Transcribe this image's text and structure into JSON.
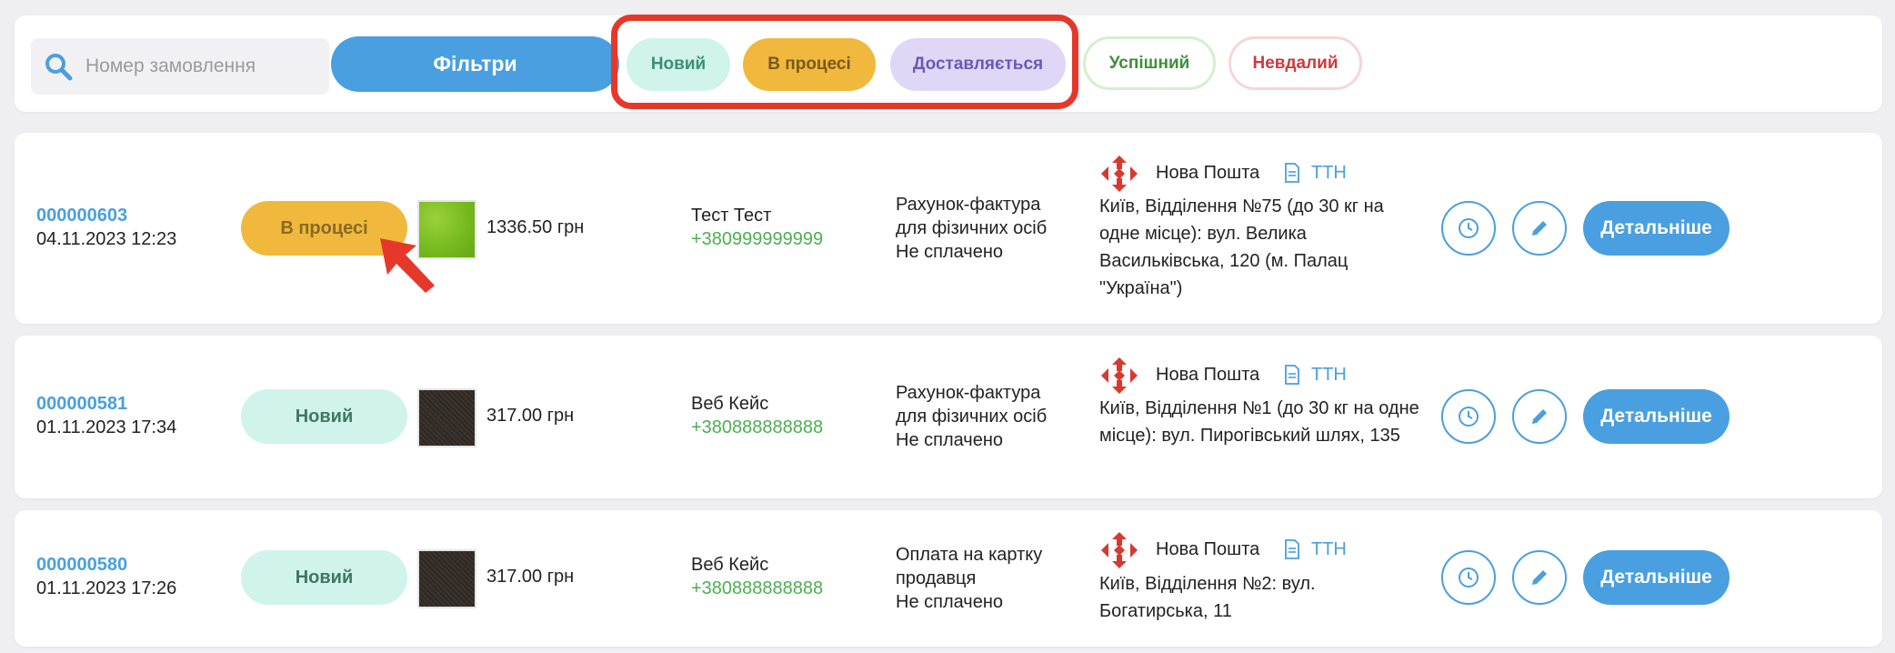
{
  "search": {
    "placeholder": "Номер замовлення"
  },
  "filters_label": "Фільтри",
  "status_filters": [
    "Новий",
    "В процесі",
    "Доставляється",
    "Успішний",
    "Невдалий"
  ],
  "colors": {
    "accent": "#4a9fe0",
    "highlight": "#e5382a",
    "status_new": "#d0f3ea",
    "status_in_progress": "#f0b83d",
    "status_delivering": "#ded8f6",
    "phone": "#4caf50"
  },
  "orders": [
    {
      "number": "000000603",
      "date": "04.11.2023 12:23",
      "status": "В процесі",
      "price": "1336.50 грн",
      "customer": "Тест Тест",
      "phone": "+380999999999",
      "payment": [
        "Рахунок-фактура",
        "для фізичних осіб",
        "Не сплачено"
      ],
      "carrier": "Нова Пошта",
      "ttn": "ТТН",
      "address": "Київ, Відділення №75 (до 30 кг на одне місце): вул. Велика Васильківська, 120 (м. Палац \"Україна\")",
      "actions": {
        "details": "Детальніше"
      }
    },
    {
      "number": "000000581",
      "date": "01.11.2023 17:34",
      "status": "Новий",
      "price": "317.00 грн",
      "customer": "Веб Кейс",
      "phone": "+380888888888",
      "payment": [
        "Рахунок-фактура",
        "для фізичних осіб",
        "Не сплачено"
      ],
      "carrier": "Нова Пошта",
      "ttn": "ТТН",
      "address": "Київ, Відділення №1 (до 30 кг на одне місце): вул. Пирогівський шлях, 135",
      "actions": {
        "details": "Детальніше"
      }
    },
    {
      "number": "000000580",
      "date": "01.11.2023 17:26",
      "status": "Новий",
      "price": "317.00 грн",
      "customer": "Веб Кейс",
      "phone": "+380888888888",
      "payment": [
        "Оплата на картку",
        "продавця",
        "Не сплачено"
      ],
      "carrier": "Нова Пошта",
      "ttn": "ТТН",
      "address": "Київ, Відділення №2: вул. Богатирська, 11",
      "actions": {
        "details": "Детальніше"
      }
    }
  ]
}
